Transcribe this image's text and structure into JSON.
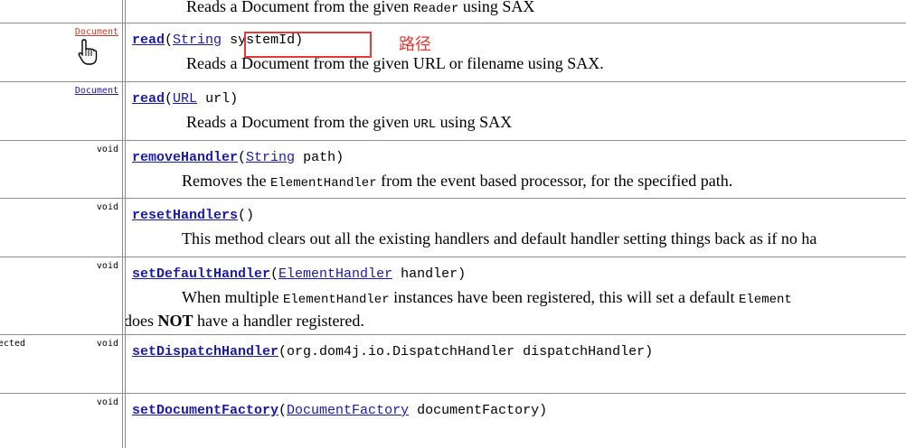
{
  "rows": [
    {
      "modifier": "",
      "signature": [],
      "description": [
        "Reads a Document from the given ",
        {
          "code": "Reader"
        },
        " using SAX"
      ]
    },
    {
      "modifier_link": "Document",
      "modifier_visited": true,
      "method": "read",
      "params": [
        {
          "type": "String",
          "name": "systemId"
        }
      ],
      "description": [
        "Reads a Document from the given URL or filename using SAX."
      ]
    },
    {
      "modifier_link": "Document",
      "method": "read",
      "params": [
        {
          "type": "URL",
          "name": "url"
        }
      ],
      "description": [
        "Reads a Document from the given ",
        {
          "code": "URL"
        },
        " using SAX"
      ]
    },
    {
      "modifier": "void",
      "method": "removeHandler",
      "params": [
        {
          "type": "String",
          "name": "path"
        }
      ],
      "description": [
        "Removes the ",
        {
          "code": "ElementHandler"
        },
        " from the event based processor, for the specified path."
      ]
    },
    {
      "modifier": "void",
      "method": "resetHandlers",
      "params": [],
      "description": [
        "This method clears out all the existing handlers and default handler setting things back as if no ha"
      ]
    },
    {
      "modifier": "void",
      "method": "setDefaultHandler",
      "params": [
        {
          "type": "ElementHandler",
          "name": "handler"
        }
      ],
      "description": [
        "When multiple ",
        {
          "code": "ElementHandler"
        },
        " instances have been registered, this will set a default ",
        {
          "code": "Element"
        }
      ],
      "description_line2": [
        "does ",
        {
          "bold": "NOT"
        },
        " have a handler registered."
      ]
    },
    {
      "modifier_protected": "protected",
      "modifier": "void",
      "method": "setDispatchHandler",
      "params_plain": "(org.dom4j.io.DispatchHandler dispatchHandler)",
      "description": []
    },
    {
      "modifier": "void",
      "method": "setDocumentFactory",
      "params": [
        {
          "type": "DocumentFactory",
          "name": "documentFactory"
        }
      ],
      "description": []
    }
  ],
  "annotation": {
    "label": "路径",
    "color": "#e53935"
  }
}
